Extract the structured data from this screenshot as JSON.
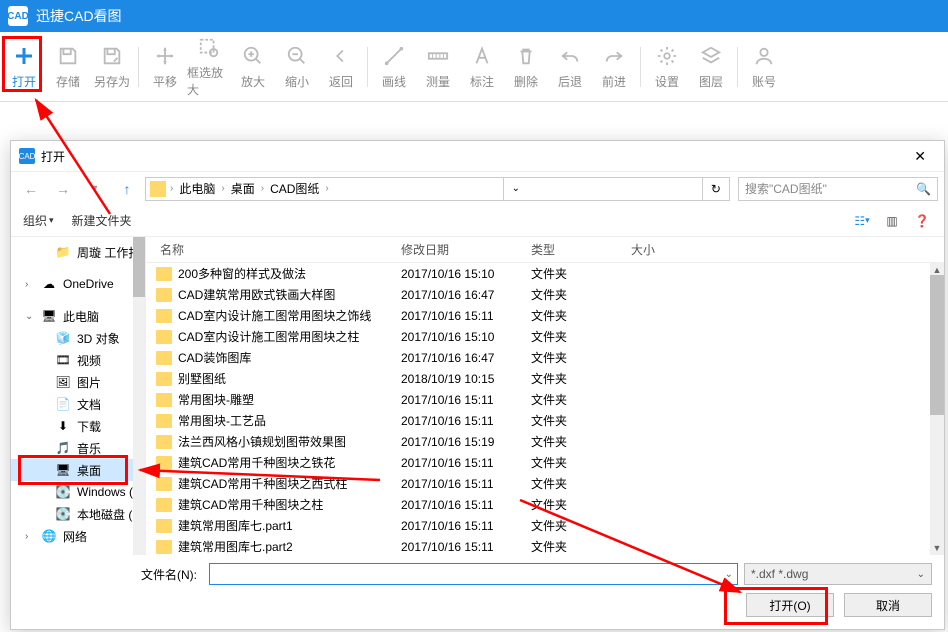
{
  "app": {
    "title": "迅捷CAD看图",
    "logo": "CAD"
  },
  "ribbon": [
    {
      "label": "打开",
      "icon": "plus",
      "primary": true
    },
    {
      "label": "存储",
      "icon": "save"
    },
    {
      "label": "另存为",
      "icon": "saveas"
    },
    {
      "sep": true
    },
    {
      "label": "平移",
      "icon": "pan"
    },
    {
      "label": "框选放大",
      "icon": "zoomrect"
    },
    {
      "label": "放大",
      "icon": "zoomin"
    },
    {
      "label": "缩小",
      "icon": "zoomout"
    },
    {
      "label": "返回",
      "icon": "back"
    },
    {
      "sep": true
    },
    {
      "label": "画线",
      "icon": "line"
    },
    {
      "label": "测量",
      "icon": "measure"
    },
    {
      "label": "标注",
      "icon": "annot"
    },
    {
      "label": "删除",
      "icon": "delete"
    },
    {
      "label": "后退",
      "icon": "undo"
    },
    {
      "label": "前进",
      "icon": "redo"
    },
    {
      "sep": true
    },
    {
      "label": "设置",
      "icon": "settings"
    },
    {
      "label": "图层",
      "icon": "layers"
    },
    {
      "sep": true
    },
    {
      "label": "账号",
      "icon": "user"
    }
  ],
  "dialog": {
    "title": "打开",
    "breadcrumb": [
      "此电脑",
      "桌面",
      "CAD图纸"
    ],
    "searchPlaceholder": "搜索\"CAD图纸\"",
    "organize": "组织",
    "newFolder": "新建文件夹",
    "columns": {
      "name": "名称",
      "date": "修改日期",
      "type": "类型",
      "size": "大小"
    },
    "tree": [
      {
        "label": "周璇 工作报",
        "icon": "folder",
        "indent": true
      },
      {
        "spacer": true
      },
      {
        "label": "OneDrive",
        "icon": "onedrive",
        "exp": ">"
      },
      {
        "spacer": true
      },
      {
        "label": "此电脑",
        "icon": "pc",
        "exp": "v"
      },
      {
        "label": "3D 对象",
        "icon": "3d",
        "indent": true
      },
      {
        "label": "视频",
        "icon": "video",
        "indent": true
      },
      {
        "label": "图片",
        "icon": "image",
        "indent": true
      },
      {
        "label": "文档",
        "icon": "doc",
        "indent": true
      },
      {
        "label": "下载",
        "icon": "download",
        "indent": true
      },
      {
        "label": "音乐",
        "icon": "music",
        "indent": true
      },
      {
        "label": "桌面",
        "icon": "desktop",
        "indent": true,
        "sel": true
      },
      {
        "label": "Windows (C",
        "icon": "disk",
        "indent": true
      },
      {
        "label": "本地磁盘 (D:",
        "icon": "disk",
        "indent": true
      },
      {
        "label": "网络",
        "icon": "net",
        "exp": ">",
        "cut": true
      }
    ],
    "files": [
      {
        "name": "200多种窗的样式及做法",
        "date": "2017/10/16 15:10",
        "type": "文件夹"
      },
      {
        "name": "CAD建筑常用欧式铁画大样图",
        "date": "2017/10/16 16:47",
        "type": "文件夹"
      },
      {
        "name": "CAD室内设计施工图常用图块之饰线",
        "date": "2017/10/16 15:11",
        "type": "文件夹"
      },
      {
        "name": "CAD室内设计施工图常用图块之柱",
        "date": "2017/10/16 15:10",
        "type": "文件夹"
      },
      {
        "name": "CAD装饰图库",
        "date": "2017/10/16 16:47",
        "type": "文件夹"
      },
      {
        "name": "别墅图纸",
        "date": "2018/10/19 10:15",
        "type": "文件夹"
      },
      {
        "name": "常用图块-雕塑",
        "date": "2017/10/16 15:11",
        "type": "文件夹"
      },
      {
        "name": "常用图块-工艺品",
        "date": "2017/10/16 15:11",
        "type": "文件夹"
      },
      {
        "name": "法兰西风格小镇规划图带效果图",
        "date": "2017/10/16 15:19",
        "type": "文件夹"
      },
      {
        "name": "建筑CAD常用千种图块之铁花",
        "date": "2017/10/16 15:11",
        "type": "文件夹"
      },
      {
        "name": "建筑CAD常用千种图块之西式柱",
        "date": "2017/10/16 15:11",
        "type": "文件夹"
      },
      {
        "name": "建筑CAD常用千种图块之柱",
        "date": "2017/10/16 15:11",
        "type": "文件夹"
      },
      {
        "name": "建筑常用图库七.part1",
        "date": "2017/10/16 15:11",
        "type": "文件夹"
      },
      {
        "name": "建筑常用图库七.part2",
        "date": "2017/10/16 15:11",
        "type": "文件夹"
      }
    ],
    "filenameLabel": "文件名(N):",
    "filter": "*.dxf *.dwg",
    "openBtn": "打开(O)",
    "cancelBtn": "取消"
  }
}
